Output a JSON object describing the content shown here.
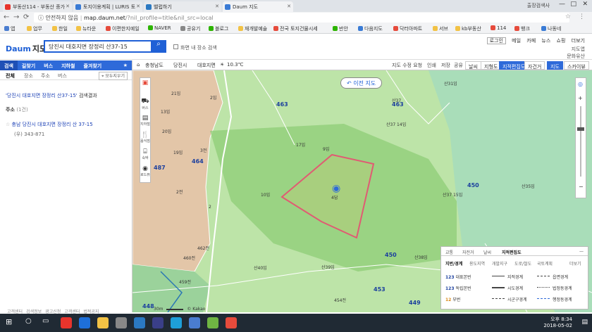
{
  "browser": {
    "tabs": [
      {
        "label": "부동산114 - 부동산 종가",
        "color": "#e7342c"
      },
      {
        "label": "토지이용계획 | LURIS 토",
        "color": "#3a7bd5"
      },
      {
        "label": "밸럽하기",
        "color": "#2b79c2"
      },
      {
        "label": "Daum 지도",
        "color": "#3a7bd5"
      }
    ],
    "user": "출장검색사",
    "address": {
      "security": "안전하지 않음",
      "url": "map.daum.net",
      "path": "/?nil_profile=title&nil_src=local"
    },
    "bookmarks": [
      {
        "label": "앱",
        "color": "#4a7dd0"
      },
      {
        "label": "업무",
        "color": "#f2c245"
      },
      {
        "label": "한일",
        "color": "#f2c245"
      },
      {
        "label": "뉴타운",
        "color": "#f2c245"
      },
      {
        "label": "이편한지예일",
        "color": "#e64b3c"
      },
      {
        "label": "NAVER",
        "color": "#2db400"
      },
      {
        "label": "공유기",
        "color": "#888888"
      },
      {
        "label": "블로그",
        "color": "#2db400"
      },
      {
        "label": "재개발예술",
        "color": "#f2c245"
      },
      {
        "label": "전국 토지건물시세",
        "color": "#e64b3c"
      },
      {
        "label": "반안",
        "color": "#2db400"
      },
      {
        "label": "다음지도",
        "color": "#3a7bd5"
      },
      {
        "label": "닥터아파트",
        "color": "#e64b3c"
      },
      {
        "label": "서브",
        "color": "#f2c245"
      },
      {
        "label": "kb부동산",
        "color": "#f2c245"
      },
      {
        "label": "114",
        "color": "#e64b3c"
      },
      {
        "label": "뱅크",
        "color": "#e64b3c"
      },
      {
        "label": "나동네",
        "color": "#3a7bd5"
      }
    ]
  },
  "header": {
    "logo": "Daum",
    "logo_suffix": "지도",
    "search_value": "당진시 대호지면 장정리 산37-15",
    "nearby_label": "화면 내 장소 검색",
    "links": [
      "로그인",
      "메일",
      "카페",
      "뉴스",
      "쇼핑",
      "더보기"
    ],
    "right_links": [
      "지도앱",
      "문화유산"
    ]
  },
  "sidebar": {
    "tabs": [
      "검색",
      "길찾기",
      "버스",
      "지하철",
      "즐겨찾기"
    ],
    "subtabs": [
      "전체",
      "장소",
      "주소",
      "버스"
    ],
    "pin_label": "모두지우기",
    "result_query": "'당진시 대호지면 장정리 산37-15'",
    "result_suffix": "검색결과",
    "address_section": "주소",
    "address_count": "(1건)",
    "address_name": "충남 당진시 대호지면 장정리 산 37-15",
    "address_zip": "(우) 343-871",
    "footer": [
      "고객센터",
      "검색정보",
      "광고신청",
      "고객센터",
      "법적공지"
    ]
  },
  "map": {
    "breadcrumb": [
      "충청남도",
      "당진시",
      "대호지면"
    ],
    "weather": "10.3℃",
    "toolbar_links": [
      "지도 수정 요청",
      "인쇄",
      "저장",
      "공유"
    ],
    "toolbar_buttons": [
      "날씨",
      "지형도",
      "지적편집도",
      "자건거",
      "지도",
      "스카이뷰"
    ],
    "active_buttons": [
      "지적편집도",
      "지도"
    ],
    "left_controls": [
      "버스",
      "지하철",
      "음식점",
      "숙박",
      "로드뷰"
    ],
    "prev_button": "이전 지도",
    "marker_label": "4답",
    "scale": "30m",
    "copyright": "© Kakao",
    "parcel_labels": [
      {
        "t": "463",
        "blue": true
      },
      {
        "t": "464",
        "blue": true
      },
      {
        "t": "487",
        "blue": true
      },
      {
        "t": "463",
        "blue": true
      },
      {
        "t": "450",
        "blue": true
      },
      {
        "t": "450",
        "blue": true
      },
      {
        "t": "453",
        "blue": true
      },
      {
        "t": "449",
        "blue": true
      },
      {
        "t": "448",
        "blue": true
      },
      {
        "t": "21임"
      },
      {
        "t": "2임"
      },
      {
        "t": "20임"
      },
      {
        "t": "19임"
      },
      {
        "t": "3전"
      },
      {
        "t": "2전"
      },
      {
        "t": "2"
      },
      {
        "t": "10임"
      },
      {
        "t": "17임"
      },
      {
        "t": "9임"
      },
      {
        "t": "산37"
      },
      {
        "t": "산37 14임"
      },
      {
        "t": "산31임"
      },
      {
        "t": "산37 15임"
      },
      {
        "t": "산35임"
      },
      {
        "t": "산38임"
      },
      {
        "t": "산39임"
      },
      {
        "t": "산40임"
      },
      {
        "t": "460전"
      },
      {
        "t": "462전"
      },
      {
        "t": "459전"
      },
      {
        "t": "454전"
      },
      {
        "t": "13임"
      }
    ]
  },
  "legend": {
    "tabs": [
      "교통",
      "자전거",
      "날씨",
      "지적편집도"
    ],
    "subtabs": [
      "지번/경계",
      "용도지역",
      "개발지구",
      "도로/철도",
      "국토계획"
    ],
    "more": "더보기",
    "rows": [
      {
        "num": "123",
        "label": "대표본번",
        "line": "지적경계",
        "line2": "읍면경계"
      },
      {
        "num": "123",
        "label": "독립본번",
        "line": "시도경계",
        "line2": "법정동경계"
      },
      {
        "num": "12",
        "label": "부번",
        "line": "시군구경계",
        "line2": "행정동경계"
      }
    ]
  },
  "taskbar": {
    "time": "오후 8:34",
    "date": "2018-05-02"
  }
}
